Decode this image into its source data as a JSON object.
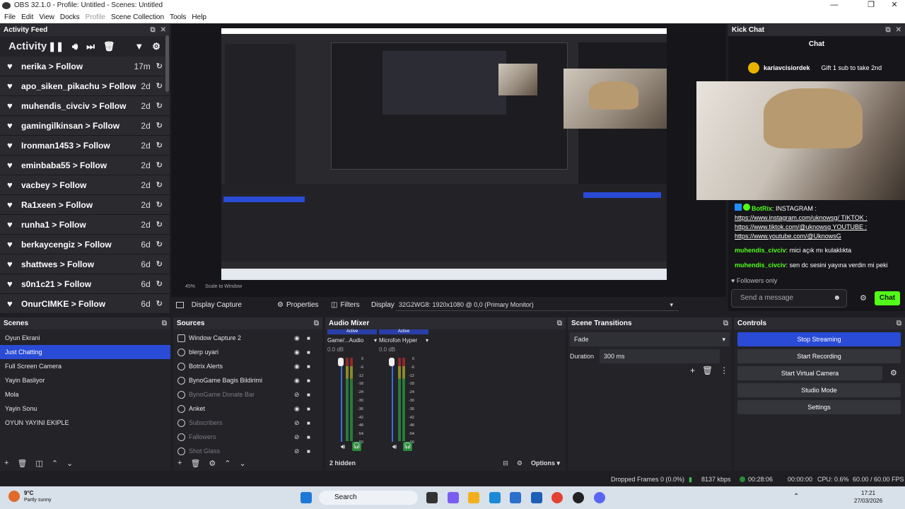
{
  "window": {
    "title": "OBS 32.1.0 - Profile: Untitled - Scenes: Untitled"
  },
  "menu": [
    "File",
    "Edit",
    "View",
    "Docks",
    "Profile",
    "Scene Collection",
    "Tools",
    "Help"
  ],
  "activity": {
    "dock_title": "Activity Feed",
    "heading": "Activity",
    "items": [
      {
        "user": "nerika",
        "action": "> Follow",
        "time": "17m"
      },
      {
        "user": "apo_siken_pikachu",
        "action": "> Follow",
        "time": "2d"
      },
      {
        "user": "muhendis_civciv",
        "action": "> Follow",
        "time": "2d"
      },
      {
        "user": "gamingilkinsan",
        "action": "> Follow",
        "time": "2d"
      },
      {
        "user": "Ironman1453",
        "action": "> Follow",
        "time": "2d"
      },
      {
        "user": "eminbaba55",
        "action": "> Follow",
        "time": "2d"
      },
      {
        "user": "vacbey",
        "action": "> Follow",
        "time": "2d"
      },
      {
        "user": "Ra1xeen",
        "action": "> Follow",
        "time": "2d"
      },
      {
        "user": "runha1",
        "action": "> Follow",
        "time": "2d"
      },
      {
        "user": "berkaycengiz",
        "action": "> Follow",
        "time": "6d"
      },
      {
        "user": "shattwes",
        "action": "> Follow",
        "time": "6d"
      },
      {
        "user": "s0n1c21",
        "action": "> Follow",
        "time": "6d"
      },
      {
        "user": "OnurCIMKE",
        "action": "> Follow",
        "time": "6d"
      }
    ]
  },
  "preview": {
    "zoom": "45%",
    "scale": "Scale to Window"
  },
  "kick": {
    "dock_title": "Kick Chat",
    "chat_title": "Chat",
    "gifter": "kariavcisiordek",
    "gift_text": "Gift 1 sub to take 2nd",
    "messages": [
      {
        "user": "BotRix",
        "text": "INSTAGRAM :",
        "lines": [
          "https://www.instagram.com/uknowsg/ TIKTOK :",
          "https://www.tiktok.com/@uknowsg YOUTUBE :",
          "https://www.youtube.com/@UknowsG"
        ]
      },
      {
        "user": "muhendis_civciv",
        "text": "mici açık mı kulaklıkta"
      },
      {
        "user": "muhendis_civciv",
        "text": "sen dc sesini yayına verdin mi peki"
      }
    ],
    "followers_only": "Followers only",
    "input_placeholder": "Send a message",
    "chat_button": "Chat"
  },
  "source_toolbar": {
    "source": "Display Capture",
    "properties": "Properties",
    "filters": "Filters",
    "display_label": "Display",
    "display_value": "32G2WG8: 1920x1080 @ 0,0 (Primary Monitor)"
  },
  "scenes": {
    "title": "Scenes",
    "items": [
      "Oyun Ekrani",
      "Just Chatting",
      "Full Screen Camera",
      "Yayin Basliyor",
      "Mola",
      "Yayin Sonu",
      "OYUN YAYINI EKIPLE"
    ],
    "selected": 1
  },
  "sources": {
    "title": "Sources",
    "items": [
      {
        "name": "Window Capture 2",
        "hidden": false
      },
      {
        "name": "blerp uyari",
        "hidden": false
      },
      {
        "name": "Botrix Alerts",
        "hidden": false
      },
      {
        "name": "BynoGame Bagis Bildirimi",
        "hidden": false
      },
      {
        "name": "BynoGame Donate Bar",
        "hidden": true
      },
      {
        "name": "Anket",
        "hidden": false
      },
      {
        "name": "Subscribers",
        "hidden": true
      },
      {
        "name": "Fallowers",
        "hidden": true
      },
      {
        "name": "Shot Glass",
        "hidden": true
      }
    ]
  },
  "mixer": {
    "title": "Audio Mixer",
    "tracks": [
      {
        "name": "Game/...Audio",
        "db": "0.0 dB",
        "status": "Active"
      },
      {
        "name": "Microfon Hyper",
        "db": "0.0 dB",
        "status": "Active"
      }
    ],
    "scale": [
      "0",
      "-6",
      "-12",
      "-18",
      "-24",
      "-30",
      "-36",
      "-42",
      "-48",
      "-54",
      "-60"
    ],
    "hidden": "2 hidden",
    "options": "Options"
  },
  "transitions": {
    "title": "Scene Transitions",
    "selected": "Fade",
    "duration_label": "Duration",
    "duration": "300 ms"
  },
  "controls": {
    "title": "Controls",
    "buttons": [
      "Stop Streaming",
      "Start Recording",
      "Start Virtual Camera",
      "Studio Mode",
      "Settings"
    ]
  },
  "status": {
    "dropped": "Dropped Frames 0 (0.0%)",
    "kbps": "8137 kbps",
    "stream_time": "00:28:06",
    "rec_time": "00:00:00",
    "cpu": "CPU: 0.6%",
    "fps": "60.00 / 60.00 FPS"
  },
  "taskbar": {
    "weather_temp": "9°C",
    "weather_desc": "Partly sunny",
    "search": "Search",
    "time": "17:21",
    "date": "27/03/2026"
  }
}
